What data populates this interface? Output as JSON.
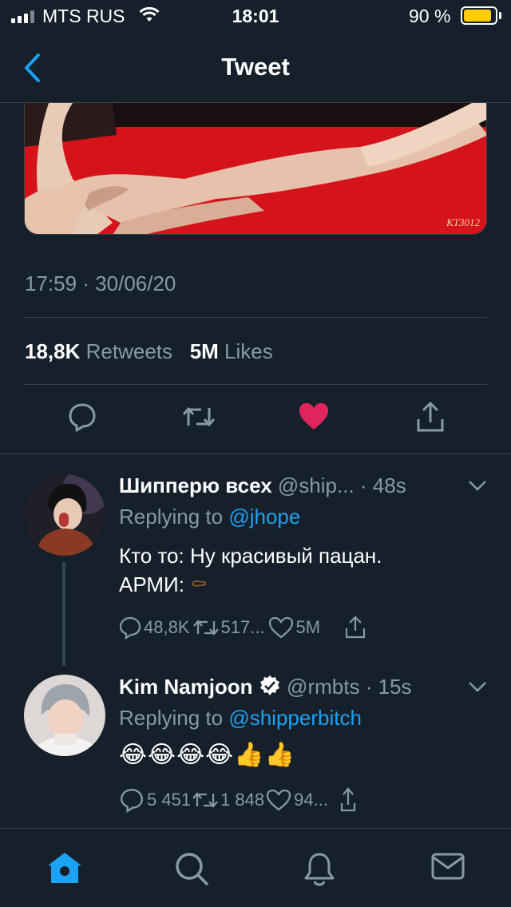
{
  "status_bar": {
    "carrier": "MTS RUS",
    "time": "18:01",
    "battery_percent": "90 %",
    "battery_level": 0.9
  },
  "nav": {
    "title": "Tweet"
  },
  "media": {
    "watermark": "KT3012"
  },
  "tweet": {
    "timestamp": "17:59 · 30/06/20",
    "retweets_count": "18,8K",
    "retweets_label": "Retweets",
    "likes_count": "5M",
    "likes_label": "Likes",
    "liked": true
  },
  "replies": [
    {
      "name": "Шипперю всех",
      "handle": "@ship...",
      "time": "· 48s",
      "replying_prefix": "Replying to",
      "replying_to": "@jhope",
      "text_line1": "Кто то: Ну красивый пацан.",
      "text_line2": "АРМИ:",
      "emoji": "⚰",
      "reply_count": "48,8K",
      "retweet_count": "517...",
      "like_count": "5M"
    },
    {
      "name": "Kim Namjoon",
      "handle": "@rmbts",
      "time": "· 15s",
      "replying_prefix": "Replying to",
      "replying_to": "@shipperbitch",
      "text": "😂😂😂😂👍👍",
      "reply_count": "5 451",
      "retweet_count": "1 848",
      "like_count": "94..."
    }
  ],
  "colors": {
    "background": "#15202b",
    "accent": "#1da1f2",
    "like": "#e0245e",
    "muted": "#8899a6",
    "divider": "#38444d"
  },
  "icons": {
    "nav_back": "chevron-left-icon",
    "tabs": [
      "home-icon",
      "search-icon",
      "bell-icon",
      "mail-icon"
    ]
  }
}
